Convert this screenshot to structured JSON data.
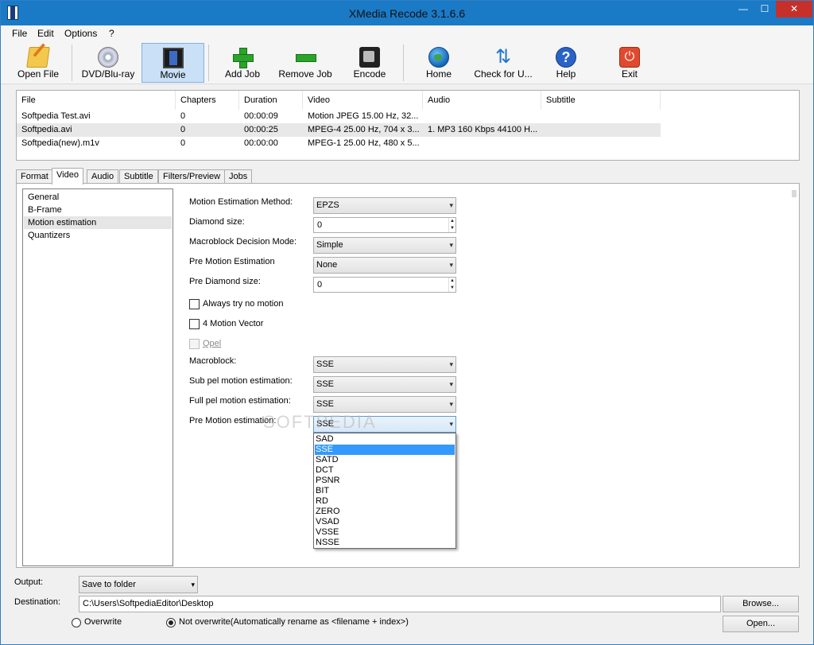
{
  "window": {
    "title": "XMedia Recode 3.1.6.6",
    "minimize_glyph": "—",
    "maximize_glyph": "☐",
    "close_glyph": "✕"
  },
  "menu": [
    "File",
    "Edit",
    "Options",
    "?"
  ],
  "toolbar": [
    {
      "label": "Open File",
      "icon": "folder-open-icon"
    },
    {
      "label": "DVD/Blu-ray",
      "icon": "disc-icon"
    },
    {
      "label": "Movie",
      "icon": "film-icon"
    },
    {
      "label": "Add Job",
      "icon": "plus-icon"
    },
    {
      "label": "Remove Job",
      "icon": "minus-icon"
    },
    {
      "label": "Encode",
      "icon": "encode-icon"
    },
    {
      "label": "Home",
      "icon": "globe-icon"
    },
    {
      "label": "Check for U...",
      "icon": "refresh-icon"
    },
    {
      "label": "Help",
      "icon": "help-icon"
    },
    {
      "label": "Exit",
      "icon": "exit-icon"
    }
  ],
  "icon_glyphs": {
    "refresh": "⇅",
    "help": "?",
    "exit": "⏻",
    "dropdown": "▾",
    "spin_up": "▲",
    "spin_down": "▼"
  },
  "files": {
    "columns": [
      "File",
      "Chapters",
      "Duration",
      "Video",
      "Audio",
      "Subtitle"
    ],
    "rows": [
      [
        "Softpedia Test.avi",
        "0",
        "00:00:09",
        "Motion JPEG 15.00 Hz, 32...",
        "",
        ""
      ],
      [
        "Softpedia.avi",
        "0",
        "00:00:25",
        "MPEG-4 25.00 Hz, 704 x 3...",
        "1. MP3 160 Kbps 44100 H...",
        ""
      ],
      [
        "Softpedia(new).m1v",
        "0",
        "00:00:00",
        "MPEG-1 25.00 Hz, 480 x 5...",
        "",
        ""
      ]
    ]
  },
  "tabs": [
    "Format",
    "Video",
    "Audio",
    "Subtitle",
    "Filters/Preview",
    "Jobs"
  ],
  "nav": [
    "General",
    "B-Frame",
    "Motion estimation",
    "Quantizers"
  ],
  "form": {
    "motion_estimation_method": {
      "label": "Motion Estimation Method:",
      "value": "EPZS"
    },
    "diamond_size": {
      "label": "Diamond size:",
      "value": "0"
    },
    "macroblock_decision_mode": {
      "label": "Macroblock Decision Mode:",
      "value": "Simple"
    },
    "pre_motion_estimation": {
      "label": "Pre Motion Estimation",
      "value": "None"
    },
    "pre_diamond_size": {
      "label": "Pre Diamond size:",
      "value": "0"
    },
    "always_try_no_motion": {
      "label": "Always try no motion",
      "checked": false
    },
    "four_motion_vector": {
      "label": "4 Motion Vector",
      "checked": false
    },
    "qpel": {
      "label": "Qpel",
      "checked": false,
      "enabled": false
    },
    "macroblock": {
      "label": "Macroblock:",
      "value": "SSE"
    },
    "sub_pel": {
      "label": "Sub pel motion estimation:",
      "value": "SSE"
    },
    "full_pel": {
      "label": "Full pel motion estimation:",
      "value": "SSE"
    },
    "pre_motion_estimation2": {
      "label": "Pre Motion estimation:",
      "value": "SSE"
    }
  },
  "dropdown_options": [
    "SAD",
    "SSE",
    "SATD",
    "DCT",
    "PSNR",
    "BIT",
    "RD",
    "ZERO",
    "VSAD",
    "VSSE",
    "NSSE"
  ],
  "dropdown_selected": "SSE",
  "watermark": "SOFTPEDIA",
  "output": {
    "label": "Output:",
    "value": "Save to folder"
  },
  "destination": {
    "label": "Destination:",
    "value": "C:\\Users\\SoftpediaEditor\\Desktop",
    "browse": "Browse...",
    "open": "Open..."
  },
  "overwrite": {
    "overwrite_label": "Overwrite",
    "not_overwrite_label": "Not overwrite(Automatically rename as <filename + index>)",
    "selected": "not_overwrite"
  }
}
